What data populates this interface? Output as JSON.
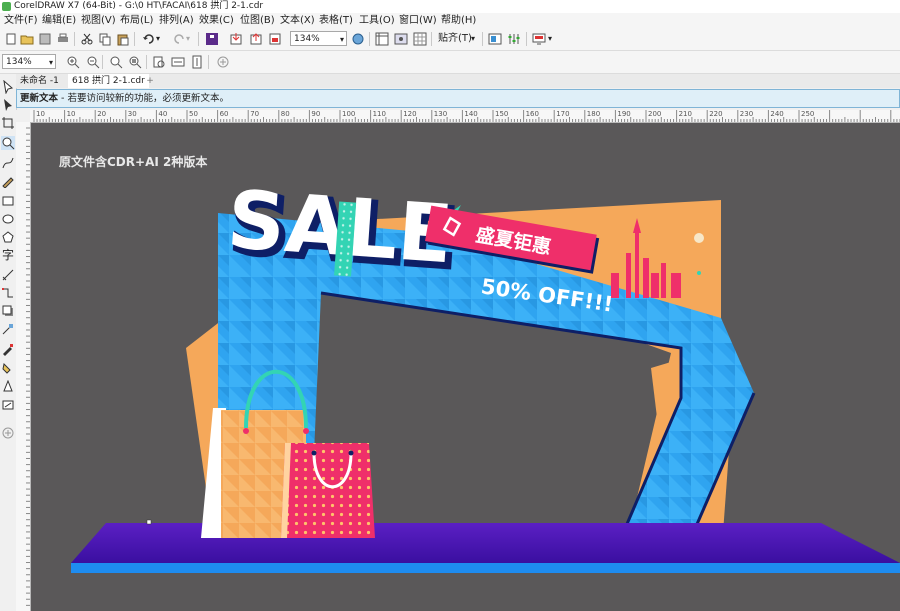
{
  "window": {
    "title": "CorelDRAW X7 (64-Bit) - G:\\0 HT\\FACAI\\618 拱门 2-1.cdr"
  },
  "menu": [
    "文件(F)",
    "编辑(E)",
    "视图(V)",
    "布局(L)",
    "排列(A)",
    "效果(C)",
    "位图(B)",
    "文本(X)",
    "表格(T)",
    "工具(O)",
    "窗口(W)",
    "帮助(H)"
  ],
  "toolbar": {
    "zoom_value": "134%",
    "snap_label": "贴齐(T)"
  },
  "property_bar": {
    "zoom_value": "134%"
  },
  "doc_tabs": [
    {
      "label": "未命名 -1"
    },
    {
      "label": "618 拱门 2-1.cdr"
    }
  ],
  "infobar": {
    "title": "更新文本",
    "message": " -  若要访问较新的功能，必须更新文本。"
  },
  "ruler": {
    "h_ticks": [
      "10",
      "10",
      "20",
      "30",
      "40",
      "50",
      "60",
      "70",
      "80",
      "90",
      "100",
      "110",
      "120",
      "130",
      "140",
      "150",
      "160",
      "170",
      "180",
      "190",
      "200",
      "210",
      "220",
      "230",
      "240",
      "250"
    ]
  },
  "artwork": {
    "note": "原文件含CDR+AI 2种版本",
    "sale_text": "SALE",
    "banner_text": "盛夏钜惠",
    "offer_text": "50% OFF!!!"
  },
  "colors": {
    "canvas_bg": "#5a5859",
    "arch_blue": "#2fa4f0",
    "orange": "#f5a85a",
    "pink": "#ef2f6a",
    "purple": "#4a15b4",
    "infobar_bg": "#dfeff8"
  }
}
